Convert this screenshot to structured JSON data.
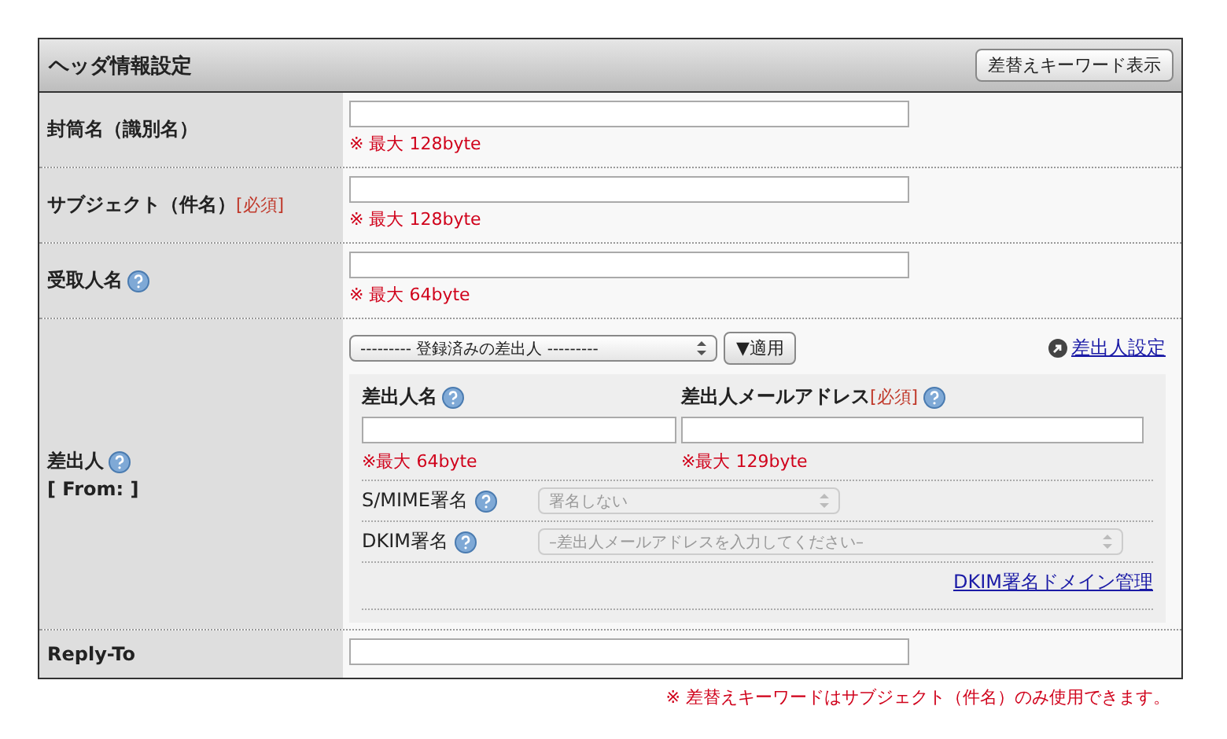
{
  "header": {
    "title": "ヘッダ情報設定",
    "button": "差替えキーワード表示"
  },
  "rows": [
    {
      "kind": "text",
      "label": "封筒名（識別名）",
      "help": false,
      "hint": "※ 最大 128byte"
    },
    {
      "kind": "text",
      "label": "サブジェクト（件名）",
      "required": "[必須]",
      "help": false,
      "hint": "※ 最大 128byte"
    },
    {
      "kind": "text",
      "label": "受取人名",
      "help": true,
      "hint": "※ 最大 64byte"
    },
    {
      "kind": "sender",
      "label": "差出人",
      "sublabel": "[ From: ]",
      "help": true,
      "preset": {
        "value": "--------- 登録済みの差出人 ---------",
        "disabled": false
      },
      "apply_button": "▼適用",
      "settings_link": "差出人設定",
      "name_field": {
        "label": "差出人名",
        "help": true,
        "hint": "※最大 64byte"
      },
      "email_field": {
        "label": "差出人メールアドレス",
        "required": "[必須]",
        "help": true,
        "hint": "※最大 129byte"
      },
      "selects": [
        {
          "label": "S/MIME署名",
          "help": true,
          "value": "署名しない",
          "disabled": true,
          "wide": false
        },
        {
          "label": "DKIM署名",
          "help": true,
          "value": "–差出人メールアドレスを入力してください–",
          "disabled": true,
          "wide": true
        }
      ],
      "dkim_link": "DKIM署名ドメイン管理"
    },
    {
      "kind": "text",
      "label": "Reply-To",
      "help": false
    }
  ],
  "note": "※ 差替えキーワードはサブジェクト（件名）のみ使用できます。"
}
